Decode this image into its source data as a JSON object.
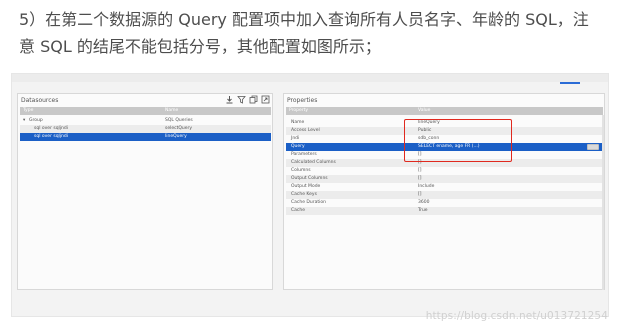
{
  "instruction": "5）在第二个数据源的 Query 配置项中加入查询所有人员名字、年龄的 SQL，注意 SQL 的结尾不能包括分号，其他配置如图所示；",
  "datasources": {
    "title": "Datasources",
    "toolbar": [
      "import-icon",
      "filter-icon",
      "copy-icon",
      "export-icon"
    ],
    "columns": {
      "type": "Type",
      "name": "Name"
    },
    "rows": [
      {
        "type": "Group",
        "name": "SQL Queries",
        "expander": "▾"
      },
      {
        "type": "sql over sqljndi",
        "name": "selectQuery"
      },
      {
        "type": "sql over sqljndi",
        "name": "lineQuery"
      }
    ]
  },
  "properties": {
    "title": "Properties",
    "columns": {
      "property": "Property",
      "value": "Value"
    },
    "rows": [
      {
        "property": "Name",
        "value": "lineQuery"
      },
      {
        "property": "Access Level",
        "value": "Public"
      },
      {
        "property": "Jndi",
        "value": "sdb_conn"
      },
      {
        "property": "Query",
        "value": "SELECT ename, age FR (...)"
      },
      {
        "property": "Parameters",
        "value": "[]"
      },
      {
        "property": "Calculated Columns",
        "value": "[]"
      },
      {
        "property": "Columns",
        "value": "[]"
      },
      {
        "property": "Output Columns",
        "value": "[]"
      },
      {
        "property": "Output Mode",
        "value": "Include"
      },
      {
        "property": "Cache Keys",
        "value": "[]"
      },
      {
        "property": "Cache Duration",
        "value": "3600"
      },
      {
        "property": "Cache",
        "value": "True"
      }
    ]
  },
  "watermark": "https://blog.csdn.net/u013721254",
  "colors": {
    "selection": "#1b5fc6",
    "highlight_box": "#e0291f"
  }
}
